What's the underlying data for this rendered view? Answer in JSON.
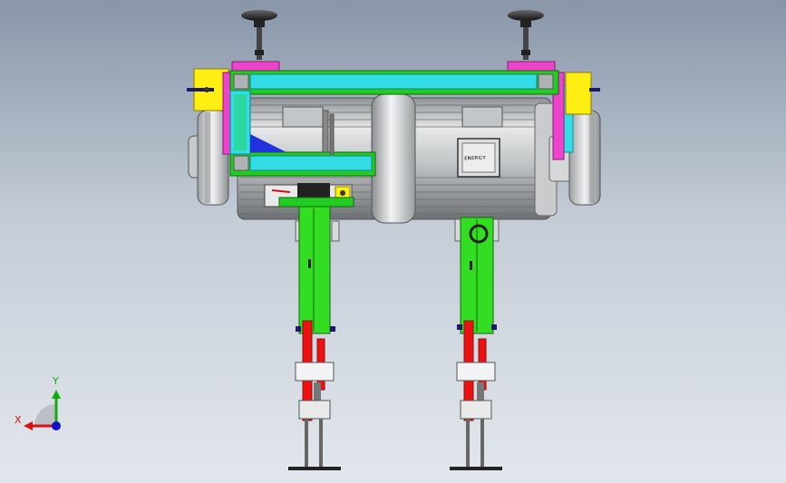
{
  "viewport": {
    "background_top": "#8896a8",
    "background_bottom": "#e3e7ed"
  },
  "model": {
    "motor_nameplate_text": "ᴇɴᴇʀɢʏ",
    "colors": {
      "frame_cyan": "#33dde6",
      "frame_green": "#22cc22",
      "leg_green": "#33dd22",
      "bracket_magenta": "#ee44cc",
      "bracket_yellow": "#ffee11",
      "rod_red": "#ee1111",
      "motor_grey": "#b9bcbe"
    }
  },
  "triad": {
    "x_label": "X",
    "y_label": "Y",
    "x_color": "#dd1111",
    "y_color": "#11aa11",
    "z_color": "#1111cc"
  }
}
